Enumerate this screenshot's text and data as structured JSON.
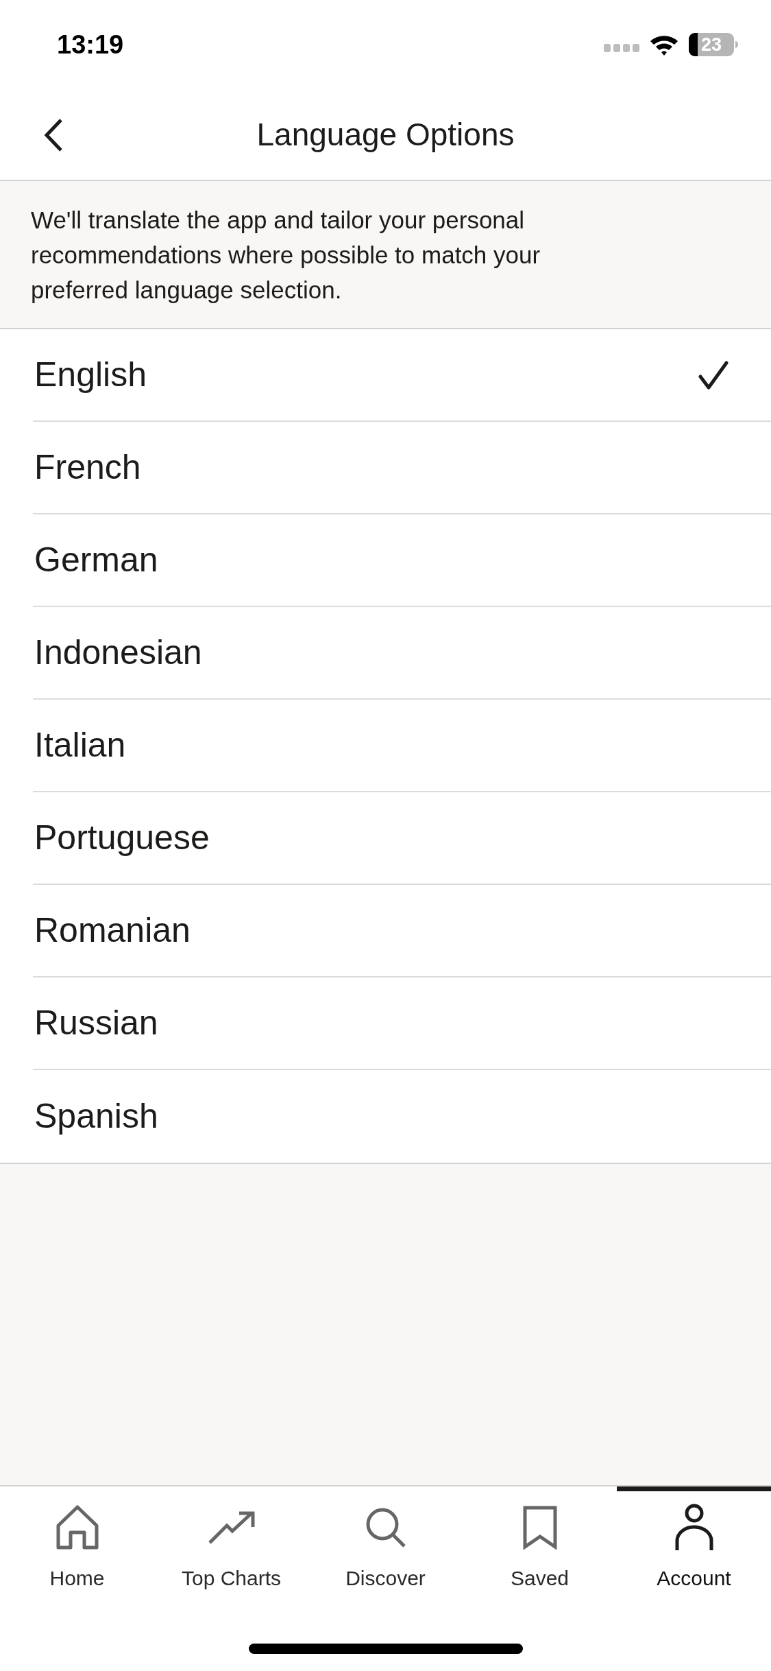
{
  "status_bar": {
    "time": "13:19",
    "battery": "23"
  },
  "header": {
    "title": "Language Options"
  },
  "info": {
    "text": "We'll translate the app and tailor your personal recommendations where possible to match your preferred language selection."
  },
  "languages": [
    {
      "label": "English",
      "selected": true
    },
    {
      "label": "French",
      "selected": false
    },
    {
      "label": "German",
      "selected": false
    },
    {
      "label": "Indonesian",
      "selected": false
    },
    {
      "label": "Italian",
      "selected": false
    },
    {
      "label": "Portuguese",
      "selected": false
    },
    {
      "label": "Romanian",
      "selected": false
    },
    {
      "label": "Russian",
      "selected": false
    },
    {
      "label": "Spanish",
      "selected": false
    }
  ],
  "tab_bar": {
    "tabs": [
      {
        "label": "Home",
        "selected": false
      },
      {
        "label": "Top Charts",
        "selected": false
      },
      {
        "label": "Discover",
        "selected": false
      },
      {
        "label": "Saved",
        "selected": false
      },
      {
        "label": "Account",
        "selected": true
      }
    ]
  }
}
